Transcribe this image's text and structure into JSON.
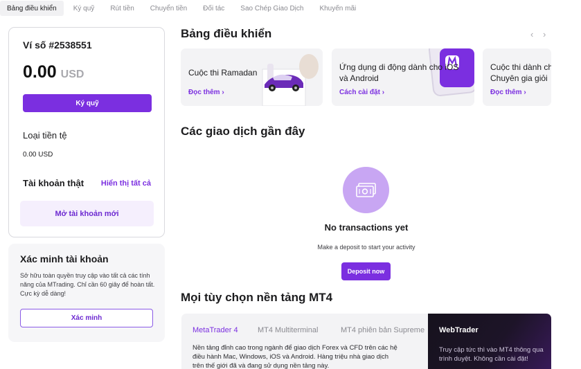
{
  "nav": {
    "tabs": [
      {
        "label": "Bảng điều khiển",
        "active": true
      },
      {
        "label": "Ký quỹ"
      },
      {
        "label": "Rút tiền"
      },
      {
        "label": "Chuyển tiền"
      },
      {
        "label": "Đối tác"
      },
      {
        "label": "Sao Chép Giao Dịch"
      },
      {
        "label": "Khuyến mãi"
      }
    ]
  },
  "wallet": {
    "title": "Ví số #2538551",
    "balance": "0.00",
    "currency": "USD",
    "deposit_label": "Ký quỹ",
    "currency_type_label": "Loại tiền tệ",
    "currency_value": "0.00 USD",
    "real_accounts_label": "Tài khoản thật",
    "show_all_label": "Hiển thị tất cả",
    "new_account_label": "Mở tài khoản mới"
  },
  "verification": {
    "title": "Xác minh tài khoản",
    "text": "Sở hữu toàn quyền truy cập vào tất cả các tính năng của MTrading. Chỉ cần 60 giây để hoàn tất. Cực kỳ dễ dàng!",
    "button": "Xác minh"
  },
  "dashboard": {
    "title": "Bảng điều khiển",
    "prev_icon": "‹",
    "next_icon": "›",
    "promos": [
      {
        "title": "Cuộc thi Ramadan",
        "link": "Đọc thêm"
      },
      {
        "title": "Ứng dụng di động dành cho iOS và Android",
        "link": "Cách cài đặt"
      },
      {
        "title": "Cuộc thi dành cho Chuyên gia giỏi",
        "link": "Đọc thêm"
      }
    ]
  },
  "recent": {
    "title": "Các giao dịch gần đây",
    "empty_title": "No transactions yet",
    "empty_text": "Make a deposit to start your activity",
    "button": "Deposit now"
  },
  "mt4": {
    "title": "Mọi tùy chọn nền tảng MT4",
    "tabs": [
      {
        "label": "MetaTrader 4",
        "active": true
      },
      {
        "label": "MT4 Multiterminal"
      },
      {
        "label": "MT4 phiên bản Supreme"
      }
    ],
    "description": "Nền tảng đỉnh cao trong ngành để giao dịch Forex và CFD trên các hệ điều hành Mac, Windows, iOS và Android. Hàng triệu nhà giao dịch trên thế giới đã và đang sử dụng nền tảng này.",
    "webtrader": {
      "title": "WebTrader",
      "text": "Truy cập tức thì vào MT4 thông qua trình duyệt. Không cần cài đặt!"
    }
  },
  "colors": {
    "accent": "#7b2fe0",
    "accent_light": "#f5effd"
  }
}
